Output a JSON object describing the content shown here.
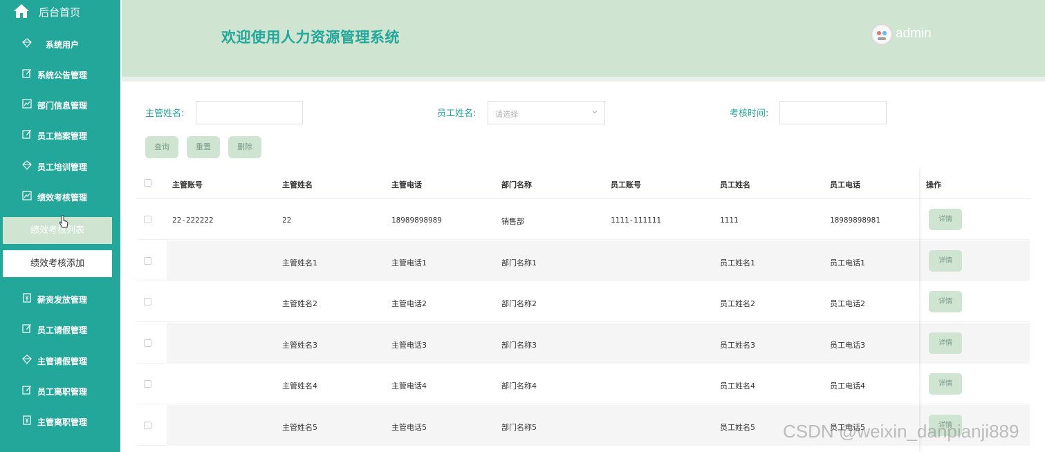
{
  "sidebar": {
    "home_label": "后台首页",
    "items": [
      {
        "label": "系统用户",
        "icon": "diamond-icon"
      },
      {
        "label": "系统公告管理",
        "icon": "edit-icon"
      },
      {
        "label": "部门信息管理",
        "icon": "chart-icon"
      },
      {
        "label": "员工档案管理",
        "icon": "edit-icon"
      },
      {
        "label": "员工培训管理",
        "icon": "diamond-icon"
      },
      {
        "label": "绩效考核管理",
        "icon": "chart-icon"
      },
      {
        "label": "薪资发放管理",
        "icon": "money-icon"
      },
      {
        "label": "员工请假管理",
        "icon": "edit-icon"
      },
      {
        "label": "主管请假管理",
        "icon": "diamond-icon"
      },
      {
        "label": "员工离职管理",
        "icon": "edit-icon"
      },
      {
        "label": "主管离职管理",
        "icon": "money-icon"
      }
    ],
    "sub_items": [
      {
        "label": "绩效考核列表",
        "active": true
      },
      {
        "label": "绩效考核添加",
        "active": false
      }
    ]
  },
  "header": {
    "title": "欢迎使用人力资源管理系统",
    "username": "admin"
  },
  "search": {
    "manager_name_label": "主管姓名:",
    "employee_name_label": "员工姓名:",
    "employee_name_placeholder": "请选择",
    "review_time_label": "考核时间:",
    "buttons": {
      "query": "查询",
      "reset": "重置",
      "delete": "删除"
    }
  },
  "table": {
    "columns": [
      "主管账号",
      "主管姓名",
      "主管电话",
      "部门名称",
      "员工账号",
      "员工姓名",
      "员工电话",
      "操作"
    ],
    "detail_label": "详情",
    "rows": [
      [
        "22-222222",
        "22",
        "18989898989",
        "销售部",
        "1111-111111",
        "1111",
        "18989898981"
      ],
      [
        "",
        "主管姓名1",
        "主管电话1",
        "部门名称1",
        "",
        "员工姓名1",
        "员工电话1"
      ],
      [
        "",
        "主管姓名2",
        "主管电话2",
        "部门名称2",
        "",
        "员工姓名2",
        "员工电话2"
      ],
      [
        "",
        "主管姓名3",
        "主管电话3",
        "部门名称3",
        "",
        "员工姓名3",
        "员工电话3"
      ],
      [
        "",
        "主管姓名4",
        "主管电话4",
        "部门名称4",
        "",
        "员工姓名4",
        "员工电话4"
      ],
      [
        "",
        "主管姓名5",
        "主管电话5",
        "部门名称5",
        "",
        "员工姓名5",
        "员工电话5"
      ]
    ]
  },
  "watermark": "CSDN @weixin_danpianji889",
  "colors": {
    "sidebar": "#23a79a",
    "header": "#cfe4d1",
    "accent": "#23a79a",
    "button": "#cfe4d1"
  }
}
